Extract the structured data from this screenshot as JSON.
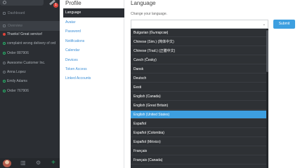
{
  "sidebar": {
    "new_badge": "1",
    "nav": [
      {
        "label": "Dashboard",
        "icon": "dashboard-icon"
      },
      {
        "label": "Overview",
        "icon": "overview-icon"
      }
    ],
    "conversations": [
      {
        "label": "Thanks! Great service!",
        "status": "red",
        "unread": true
      },
      {
        "label": "complaint wrong delivery of ord",
        "status": "green",
        "unread": false
      },
      {
        "label": "Order 887906",
        "status": "green",
        "unread": false
      },
      {
        "label": "Awesome Customer Inc.",
        "status": "grey",
        "unread": false
      },
      {
        "label": "Anna Lopez",
        "status": "grey",
        "unread": false
      },
      {
        "label": "Emily Adams",
        "status": "green",
        "unread": false
      },
      {
        "label": "Order 767906",
        "status": "green",
        "unread": false
      }
    ],
    "bottom_icons": [
      "stats-icon",
      "settings-icon",
      "plus-icon"
    ]
  },
  "profile": {
    "title": "Profile",
    "menu": [
      {
        "label": "Language",
        "active": true
      },
      {
        "label": "Avatar",
        "active": false
      },
      {
        "label": "Password",
        "active": false
      },
      {
        "label": "Notifications",
        "active": false
      },
      {
        "label": "Calendar",
        "active": false
      },
      {
        "label": "Devices",
        "active": false
      },
      {
        "label": "Token Access",
        "active": false
      },
      {
        "label": "Linked Accounts",
        "active": false
      }
    ]
  },
  "main": {
    "title": "Language",
    "description": "Change your language.",
    "select_value": "",
    "submit_label": "Submit",
    "options": [
      "Bulgarian (български)",
      "Chinese (Sim.) (简体中文)",
      "Chinese (Trad.) (正體中文)",
      "Czech (Česky)",
      "Dansk",
      "Deutsch",
      "Eesti",
      "English (Canada)",
      "English (Great Britain)",
      "English (United States)",
      "Español",
      "Español (Colombia)",
      "Español (México)",
      "Français",
      "Français (Canada)"
    ],
    "selected_option": "English (United States)"
  },
  "colors": {
    "accent": "#3d9fe0",
    "sidebar_bg": "#2b2e33",
    "link": "#3d8fd6",
    "online": "#27b46a",
    "alert": "#e0443b"
  }
}
